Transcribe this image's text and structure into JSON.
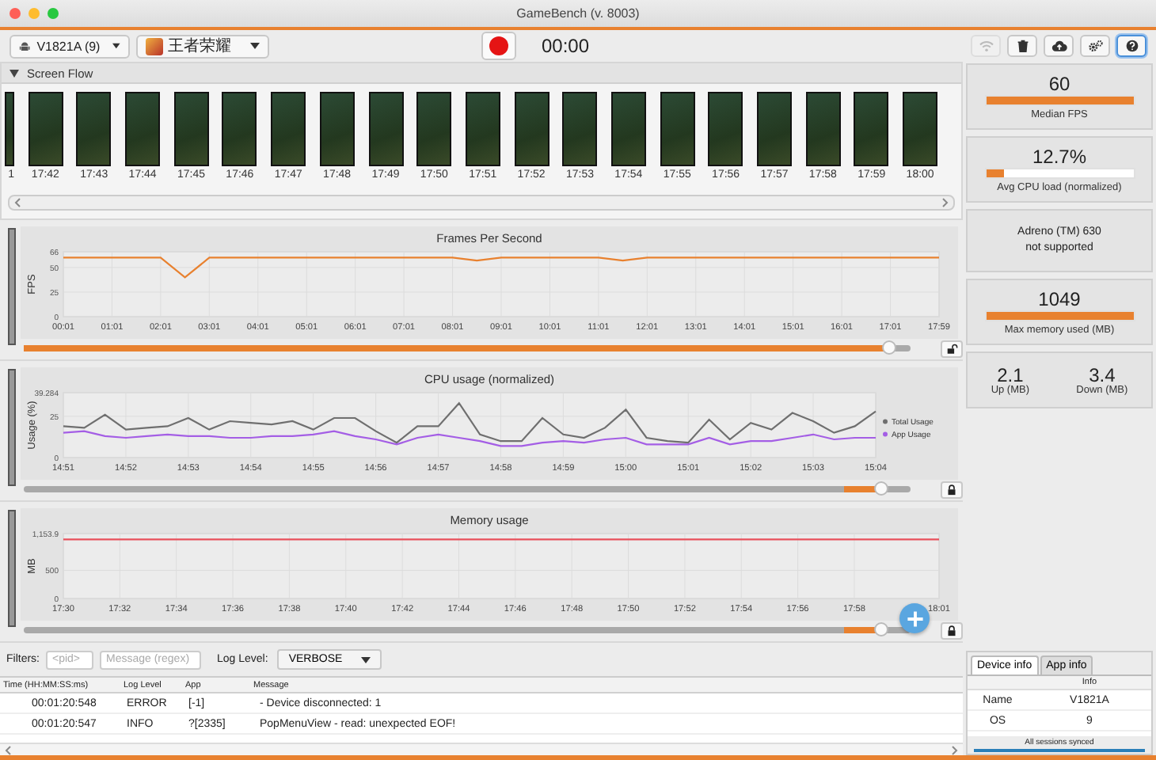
{
  "window": {
    "title": "GameBench (v. 8003)"
  },
  "toolbar": {
    "device": "V1821A (9)",
    "app": "王者荣耀",
    "timer": "00:00",
    "buttons": [
      {
        "kind": "wifi",
        "disabled": true,
        "selected": false
      },
      {
        "kind": "trash",
        "disabled": false,
        "selected": false
      },
      {
        "kind": "upload",
        "disabled": false,
        "selected": false
      },
      {
        "kind": "settings",
        "disabled": false,
        "selected": false
      },
      {
        "kind": "help",
        "disabled": false,
        "selected": true
      }
    ]
  },
  "screen_flow": {
    "title": "Screen Flow",
    "expanded": true,
    "frames": [
      {
        "time": "1",
        "partial": true
      },
      {
        "time": "17:42",
        "partial": false
      },
      {
        "time": "17:43",
        "partial": false
      },
      {
        "time": "17:44",
        "partial": false
      },
      {
        "time": "17:45",
        "partial": false
      },
      {
        "time": "17:46",
        "partial": false
      },
      {
        "time": "17:47",
        "partial": false
      },
      {
        "time": "17:48",
        "partial": false
      },
      {
        "time": "17:49",
        "partial": false
      },
      {
        "time": "17:50",
        "partial": false
      },
      {
        "time": "17:51",
        "partial": false
      },
      {
        "time": "17:52",
        "partial": false
      },
      {
        "time": "17:53",
        "partial": false
      },
      {
        "time": "17:54",
        "partial": false
      },
      {
        "time": "17:55",
        "partial": false
      },
      {
        "time": "17:56",
        "partial": false
      },
      {
        "time": "17:57",
        "partial": false
      },
      {
        "time": "17:58",
        "partial": false
      },
      {
        "time": "17:59",
        "partial": false
      },
      {
        "time": "18:00",
        "partial": false
      }
    ]
  },
  "charts": [
    {
      "locked": false,
      "slider": {
        "kind": "full",
        "level": 0.97
      },
      "chart_data": {
        "type": "line",
        "title": "Frames Per Second",
        "ylabel": "FPS",
        "grid": true,
        "ylim": [
          0,
          66
        ],
        "yticks": [
          0,
          25,
          50,
          66
        ],
        "categories": [
          "00:01",
          null,
          "01:01",
          null,
          "02:01",
          null,
          "03:01",
          null,
          "04:01",
          null,
          "05:01",
          null,
          "06:01",
          null,
          "07:01",
          null,
          "08:01",
          null,
          "09:01",
          null,
          "10:01",
          null,
          "11:01",
          null,
          "12:01",
          null,
          "13:01",
          null,
          "14:01",
          null,
          "15:01",
          null,
          "16:01",
          null,
          "17:01",
          null,
          "17:59"
        ],
        "series": [
          {
            "color": "#e8812f",
            "values": [
              60,
              60,
              60,
              60,
              60,
              40,
              60,
              60,
              60,
              60,
              60,
              60,
              60,
              60,
              60,
              60,
              60,
              57,
              60,
              60,
              60,
              60,
              60,
              57,
              60,
              60,
              60,
              60,
              60,
              60,
              60,
              60,
              60,
              60,
              60,
              60,
              60
            ]
          }
        ]
      }
    },
    {
      "locked": true,
      "slider": {
        "kind": "window",
        "level": 0.96
      },
      "chart_data": {
        "type": "line",
        "title": "CPU usage (normalized)",
        "ylabel": "Usage (%)",
        "grid": true,
        "legend": true,
        "ylim": [
          0,
          39.284
        ],
        "yticks": [
          0,
          25,
          {
            "value": 39.284,
            "label": "39.284"
          }
        ],
        "categories": [
          "14:51",
          null,
          null,
          "14:52",
          null,
          null,
          "14:53",
          null,
          null,
          "14:54",
          null,
          null,
          "14:55",
          null,
          null,
          "14:56",
          null,
          null,
          "14:57",
          null,
          null,
          "14:58",
          null,
          null,
          "14:59",
          null,
          null,
          "15:00",
          null,
          null,
          "15:01",
          null,
          null,
          "15:02",
          null,
          null,
          "15:03",
          null,
          null,
          "15:04"
        ],
        "series": [
          {
            "name": "Total Usage",
            "color": "#6f6f6f",
            "values": [
              19,
              18,
              26,
              17,
              18,
              19,
              24,
              17,
              22,
              21,
              20,
              22,
              17,
              24,
              24,
              16,
              9,
              19,
              19,
              33,
              14,
              10,
              10,
              24,
              14,
              12,
              18,
              29,
              12,
              10,
              9,
              23,
              11,
              21,
              17,
              27,
              22,
              15,
              19,
              28
            ]
          },
          {
            "name": "App Usage",
            "color": "#a45ee5",
            "values": [
              15,
              16,
              13,
              12,
              13,
              14,
              13,
              13,
              12,
              12,
              13,
              13,
              14,
              16,
              13,
              11,
              8,
              12,
              14,
              12,
              10,
              7,
              7,
              9,
              10,
              9,
              11,
              12,
              8,
              8,
              8,
              12,
              8,
              10,
              10,
              12,
              14,
              11,
              12,
              12
            ]
          }
        ]
      }
    },
    {
      "locked": true,
      "slider": {
        "kind": "window",
        "level": 0.96
      },
      "chart_data": {
        "type": "line",
        "title": "Memory usage",
        "ylabel": "MB",
        "grid": true,
        "ylim": [
          0,
          1153.9
        ],
        "yticks": [
          0,
          500,
          {
            "value": 1153.9,
            "label": "1,153.9"
          }
        ],
        "categories": [
          "17:30",
          null,
          "17:32",
          null,
          "17:34",
          null,
          "17:36",
          null,
          "17:38",
          null,
          "17:40",
          null,
          "17:42",
          null,
          "17:44",
          null,
          "17:46",
          null,
          "17:48",
          null,
          "17:50",
          null,
          "17:52",
          null,
          "17:54",
          null,
          "17:56",
          null,
          "17:58",
          null,
          null,
          "18:01"
        ],
        "series": [
          {
            "color": "#e8505b",
            "values": [
              1050,
              1050,
              1050,
              1050,
              1050,
              1050,
              1050,
              1050,
              1050,
              1050,
              1050,
              1050,
              1050,
              1050,
              1050,
              1050,
              1050,
              1050,
              1050,
              1050,
              1050,
              1050,
              1050,
              1050,
              1050,
              1050,
              1050,
              1050,
              1050,
              1050,
              1050,
              1050
            ]
          }
        ]
      }
    }
  ],
  "log": {
    "filters_label": "Filters:",
    "pid_placeholder": "<pid>",
    "message_placeholder": "Message (regex)",
    "level_label": "Log Level:",
    "level": "VERBOSE",
    "columns": [
      "Time (HH:MM:SS:ms)",
      "Log Level",
      "App",
      "Message"
    ],
    "rows": [
      [
        "00:01:20:548",
        "ERROR",
        "[-1]",
        "- Device disconnected: 1"
      ],
      [
        "00:01:20:547",
        "INFO",
        "?[2335]",
        "PopMenuView - read: unexpected EOF!"
      ]
    ]
  },
  "stats": [
    {
      "kind": "meter",
      "value": "60",
      "level": 1,
      "label": "Median FPS"
    },
    {
      "kind": "meter",
      "value": "12.7%",
      "level": 0.127,
      "label": "Avg CPU load (normalized)"
    },
    {
      "kind": "text",
      "lines": [
        "Adreno (TM) 630",
        "not supported"
      ]
    },
    {
      "kind": "meter",
      "value": "1049",
      "level": 1,
      "label": "Max memory used (MB)"
    },
    {
      "kind": "pair",
      "items": [
        {
          "value": "2.1",
          "label": "Up (MB)"
        },
        {
          "value": "3.4",
          "label": "Down (MB)"
        }
      ]
    }
  ],
  "info_panel": {
    "tabs": [
      {
        "label": "Device info",
        "selected": true
      },
      {
        "label": "App info",
        "selected": false
      }
    ],
    "heading": "Info",
    "rows": [
      [
        "Name",
        "V1821A"
      ],
      [
        "OS",
        "9"
      ]
    ],
    "status": "All sessions synced",
    "sync": {
      "level": 1
    }
  }
}
